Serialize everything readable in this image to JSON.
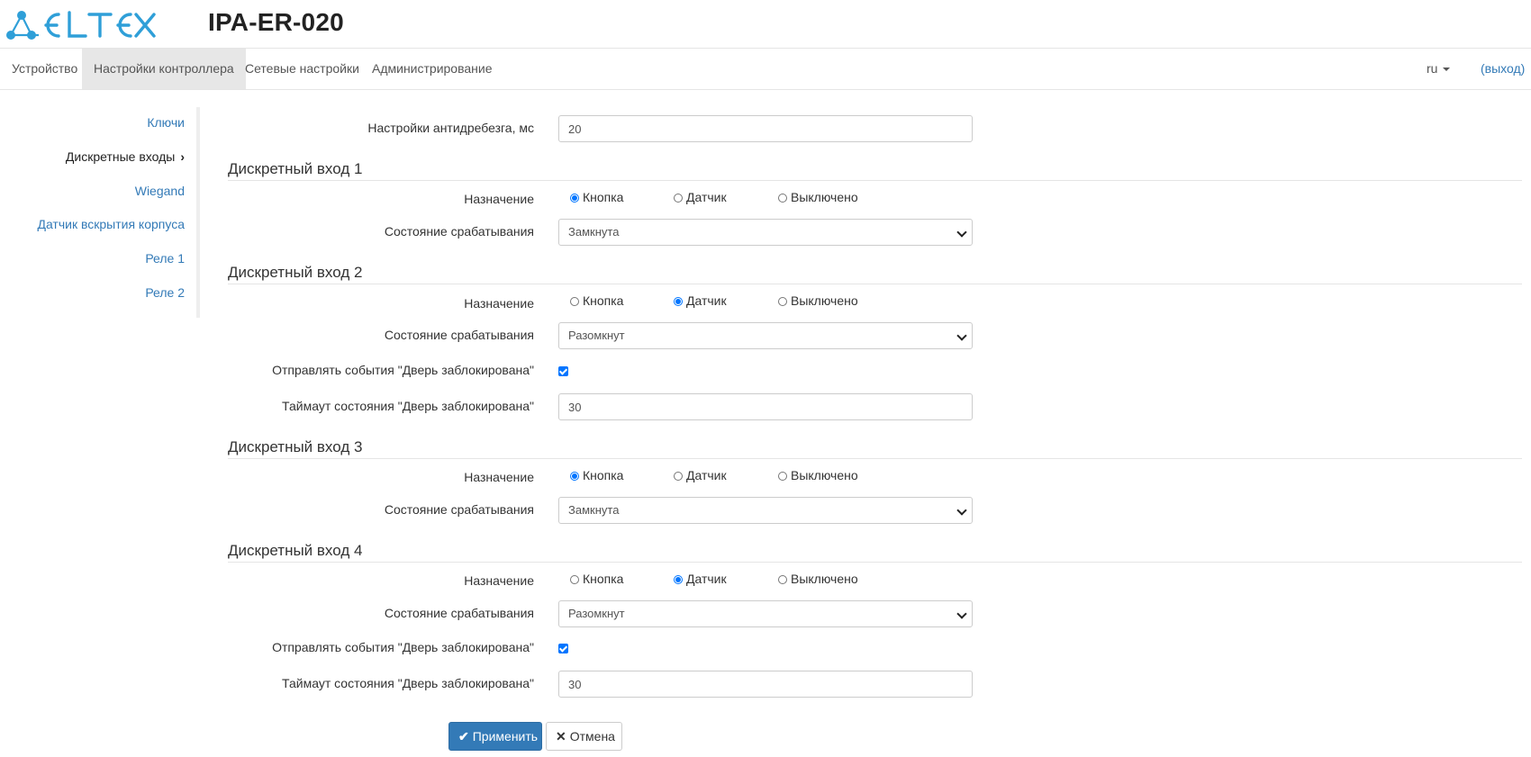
{
  "header": {
    "brand": "ELTEX",
    "device_title": "IPA-ER-020"
  },
  "nav": {
    "items": [
      {
        "label": "Устройство"
      },
      {
        "label": "Настройки контроллера",
        "active": true
      },
      {
        "label": "Сетевые настройки"
      },
      {
        "label": "Администрирование"
      }
    ],
    "lang": "ru",
    "logout": "(выход)"
  },
  "sidebar": {
    "items": [
      {
        "label": "Ключи"
      },
      {
        "label": "Дискретные входы",
        "active": true
      },
      {
        "label": "Wiegand"
      },
      {
        "label": "Датчик вскрытия корпуса"
      },
      {
        "label": "Реле 1"
      },
      {
        "label": "Реле 2"
      }
    ]
  },
  "form": {
    "debounce_label": "Настройки антидребезга, мс",
    "debounce_value": "20",
    "purpose_label": "Назначение",
    "state_label": "Состояние срабатывания",
    "send_events_label": "Отправлять события \"Дверь заблокирована\"",
    "timeout_label": "Таймаут состояния \"Дверь заблокирована\"",
    "radio_options": [
      "Кнопка",
      "Датчик",
      "Выключено"
    ],
    "inputs": [
      {
        "title": "Дискретный вход 1",
        "purpose": "Кнопка",
        "state": "Замкнута"
      },
      {
        "title": "Дискретный вход 2",
        "purpose": "Датчик",
        "state": "Разомкнут",
        "send_events": true,
        "timeout": "30"
      },
      {
        "title": "Дискретный вход 3",
        "purpose": "Кнопка",
        "state": "Замкнута"
      },
      {
        "title": "Дискретный вход 4",
        "purpose": "Датчик",
        "state": "Разомкнут",
        "send_events": true,
        "timeout": "30"
      }
    ]
  },
  "buttons": {
    "apply": "Применить",
    "cancel": "Отмена"
  },
  "colors": {
    "brand": "#2f9fd8",
    "link": "#337ab7",
    "primary": "#337ab7",
    "radio_selected": "#0075ff"
  },
  "icons": {
    "logo": "eltex-logo",
    "apply": "check-icon",
    "cancel": "close-icon",
    "active_sidebar": "chevron-right-icon",
    "dropdown": "chevron-down-icon"
  }
}
